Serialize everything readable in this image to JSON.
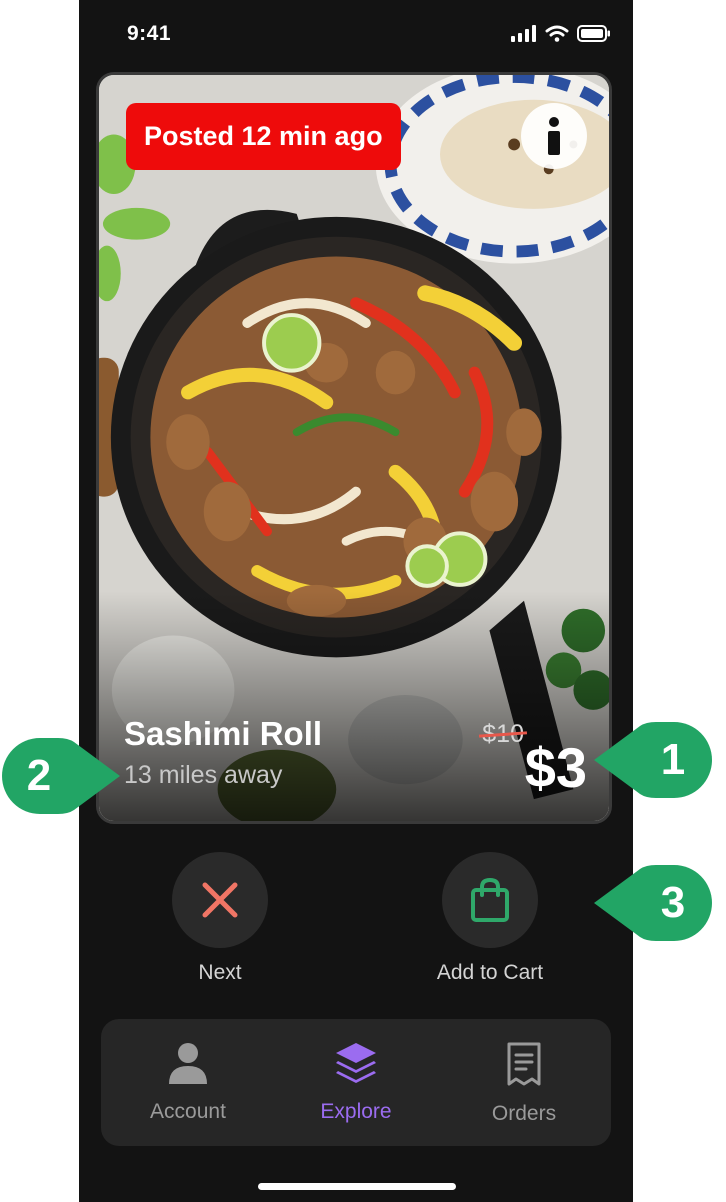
{
  "status_bar": {
    "time": "9:41"
  },
  "listing": {
    "posted_badge": "Posted 12 min ago",
    "title": "Sashimi Roll",
    "distance": "13 miles away",
    "old_price": "$10",
    "price": "$3"
  },
  "actions": {
    "next_label": "Next",
    "add_to_cart_label": "Add to Cart"
  },
  "nav": {
    "items": [
      {
        "label": "Account",
        "icon": "person-icon",
        "active": false
      },
      {
        "label": "Explore",
        "icon": "layers-icon",
        "active": true
      },
      {
        "label": "Orders",
        "icon": "receipt-icon",
        "active": false
      }
    ]
  },
  "callouts": [
    "1",
    "2",
    "3"
  ],
  "colors": {
    "accent": "#9b6cf0",
    "badge_red": "#ee0b0b",
    "callout_green": "#22a565",
    "next_x": "#f07565",
    "cart_green": "#2fa86a"
  }
}
